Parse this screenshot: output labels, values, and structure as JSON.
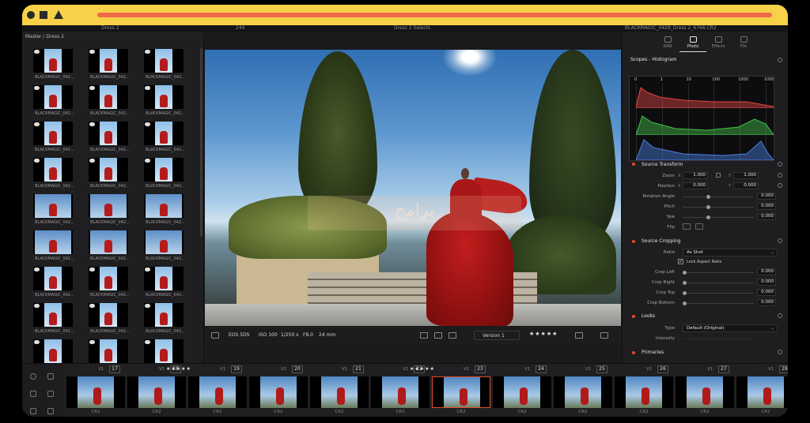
{
  "titlebar": {
    "shapes": [
      "circle-icon",
      "square-icon",
      "triangle-icon"
    ]
  },
  "menubar": {
    "items": [
      "Dress 2",
      "244",
      "Dress 2 Selects",
      "BLACKMAGIC_0428_Dress 2_6766.CR2"
    ]
  },
  "pool": {
    "path": "Master / Dress 2",
    "clip_label": "BLACKMAGIC_042...",
    "rows": 9,
    "cols": 3
  },
  "viewer": {
    "watermark": "برامج",
    "info": {
      "camera": "EOS 5DS",
      "iso": "ISO 100",
      "shutter": "1/250 s",
      "aperture": "F8.0",
      "focal": "24 mm",
      "version": "Version 1",
      "rating": "★★★★★"
    }
  },
  "inspector": {
    "file_name": "BLACKMAGIC_0428_Dress 2_6766.CR2",
    "tabs": [
      {
        "label": "RAW",
        "icon": "raw-icon",
        "active": false
      },
      {
        "label": "Photo",
        "icon": "camera-icon",
        "active": true
      },
      {
        "label": "Effects",
        "icon": "wand-icon",
        "active": false
      },
      {
        "label": "File",
        "icon": "file-icon",
        "active": false
      }
    ],
    "scopes_title": "Scopes - Histogram",
    "histogram_scale": [
      "0",
      "1",
      "10",
      "100",
      "1000",
      "10000"
    ],
    "source_transform": {
      "title": "Source Transform",
      "zoom_label": "Zoom",
      "zoom_x": "1.000",
      "zoom_y": "1.000",
      "position_label": "Position",
      "position_x": "0.000",
      "position_y": "0.000",
      "rotation_label": "Rotation Angle",
      "rotation": "0.000",
      "pitch_label": "Pitch",
      "pitch": "0.000",
      "yaw_label": "Yaw",
      "yaw": "0.000",
      "flip_label": "Flip",
      "x_axis": "X",
      "y_axis": "Y"
    },
    "source_cropping": {
      "title": "Source Cropping",
      "ratio_label": "Ratio",
      "ratio": "As Shot",
      "lock_label": "Lock Aspect Ratio",
      "crop_left_label": "Crop Left",
      "crop_left": "0.000",
      "crop_right_label": "Crop Right",
      "crop_right": "0.000",
      "crop_top_label": "Crop Top",
      "crop_top": "0.000",
      "crop_bottom_label": "Crop Bottom",
      "crop_bottom": "0.000"
    },
    "looks": {
      "title": "Looks",
      "type_label": "Type",
      "type": "Default (Original)",
      "intensity_label": "Intensity"
    },
    "primaries": {
      "title": "Primaries"
    }
  },
  "filmstrip": {
    "track": "V1",
    "clips": [
      {
        "num": "17",
        "rating": "",
        "ext": "CR2",
        "selected": false
      },
      {
        "num": "18",
        "rating": "",
        "ext": "CR2",
        "selected": false
      },
      {
        "num": "19",
        "rating": "★★★★★",
        "ext": "CR2",
        "selected": false
      },
      {
        "num": "20",
        "rating": "",
        "ext": "CR2",
        "selected": false
      },
      {
        "num": "21",
        "rating": "",
        "ext": "CR2",
        "selected": false
      },
      {
        "num": "22",
        "rating": "",
        "ext": "CR2",
        "selected": false
      },
      {
        "num": "23",
        "rating": "★★★★★",
        "ext": "CR2",
        "selected": true
      },
      {
        "num": "24",
        "rating": "",
        "ext": "CR2",
        "selected": false
      },
      {
        "num": "25",
        "rating": "",
        "ext": "CR2",
        "selected": false
      },
      {
        "num": "26",
        "rating": "",
        "ext": "CR2",
        "selected": false
      },
      {
        "num": "27",
        "rating": "",
        "ext": "CR2",
        "selected": false
      },
      {
        "num": "28",
        "rating": "",
        "ext": "CR2",
        "selected": false
      }
    ]
  },
  "colors": {
    "titlebar": "#f7d147",
    "accent_bar": "#ef6a4c",
    "section_dot": "#e24b2a",
    "histogram_red": "#e04545",
    "histogram_green": "#45c24a",
    "histogram_blue": "#4a7fe0"
  }
}
